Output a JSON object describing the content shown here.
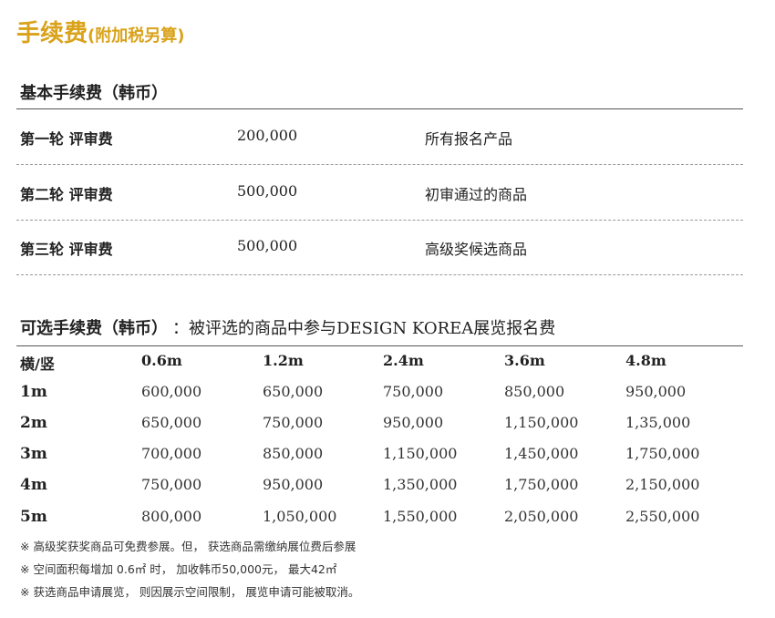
{
  "title": {
    "main": "手续费",
    "sub": "(附加税另算)"
  },
  "basic": {
    "heading": "基本手续费（韩币）",
    "rows": [
      {
        "round": "第一轮  评审费",
        "fee": "200,000",
        "target": "所有报名产品"
      },
      {
        "round": "第二轮  评审费",
        "fee": "500,000",
        "target": "初审通过的商品"
      },
      {
        "round": "第三轮  评审费",
        "fee": "500,000",
        "target": "高级奖候选商品"
      }
    ]
  },
  "optional": {
    "heading": "可选手续费（韩币）",
    "note": "：被评选的商品中参与DESIGN  KOREA展览报名费",
    "corner": "横/竖",
    "columns": [
      "0.6m",
      "1.2m",
      "2.4m",
      "3.6m",
      "4.8m"
    ],
    "rows": [
      {
        "label": "1m",
        "values": [
          "600,000",
          "650,000",
          "750,000",
          "850,000",
          "950,000"
        ]
      },
      {
        "label": "2m",
        "values": [
          "650,000",
          "750,000",
          "950,000",
          "1,150,000",
          "1,35,000"
        ]
      },
      {
        "label": "3m",
        "values": [
          "700,000",
          "850,000",
          "1,150,000",
          "1,450,000",
          "1,750,000"
        ]
      },
      {
        "label": "4m",
        "values": [
          "750,000",
          "950,000",
          "1,350,000",
          "1,750,000",
          "2,150,000"
        ]
      },
      {
        "label": "5m",
        "values": [
          "800,000",
          "1,050,000",
          "1,550,000",
          "2,050,000",
          "2,550,000"
        ]
      }
    ]
  },
  "footnotes": [
    "※  高级奖获奖商品可免费参展。但， 获选商品需缴纳展位费后参展",
    "※  空间面积每增加  0.6㎡  时，  加收韩币50,000元，  最大42㎡",
    "※  获选商品申请展览，  则因展示空间限制，  展览申请可能被取消。"
  ]
}
